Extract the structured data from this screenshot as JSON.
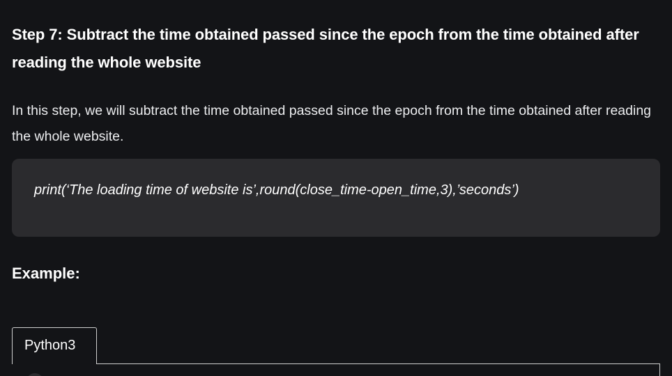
{
  "article": {
    "step_heading": "Step 7: Subtract the time obtained passed since the epoch from the time obtained after reading the whole website",
    "description": "In this step, we will subtract the time obtained passed since the epoch from the time obtained after reading the whole website.",
    "code_snippet": "print(‘The loading time of website is’,round(close_time-open_time,3),’seconds’)",
    "example_heading": "Example:",
    "code_tab_label": "Python3"
  }
}
